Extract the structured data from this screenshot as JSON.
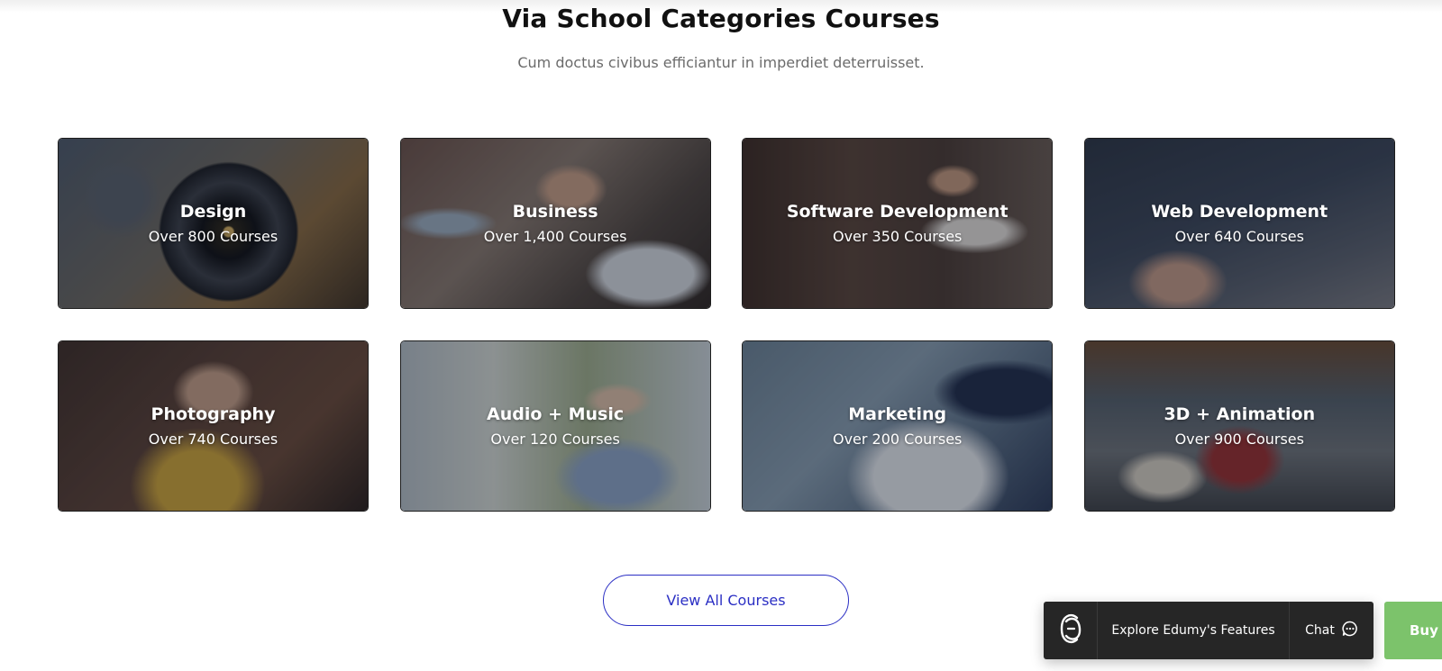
{
  "section": {
    "title": "Via School Categories Courses",
    "subtitle": "Cum doctus civibus efficiantur in imperdiet deterruisset."
  },
  "categories": [
    {
      "name": "Design",
      "count": "Over 800 Courses"
    },
    {
      "name": "Business",
      "count": "Over 1,400 Courses"
    },
    {
      "name": "Software Development",
      "count": "Over 350 Courses"
    },
    {
      "name": "Web Development",
      "count": "Over 640 Courses"
    },
    {
      "name": "Photography",
      "count": "Over 740 Courses"
    },
    {
      "name": "Audio + Music",
      "count": "Over 120 Courses"
    },
    {
      "name": "Marketing",
      "count": "Over 200 Courses"
    },
    {
      "name": "3D + Animation",
      "count": "Over 900 Courses"
    }
  ],
  "view_all_label": "View All Courses",
  "floating_bar": {
    "explore_label": "Explore Edumy's Features",
    "chat_label": "Chat",
    "logo_icon": "edumy-logo-icon",
    "chat_icon": "chat-bubble-icon"
  },
  "buy_button_label": "Buy N",
  "colors": {
    "accent": "#2b2fc4",
    "buy_green": "#7cc36b",
    "bar_dark": "#262626"
  }
}
